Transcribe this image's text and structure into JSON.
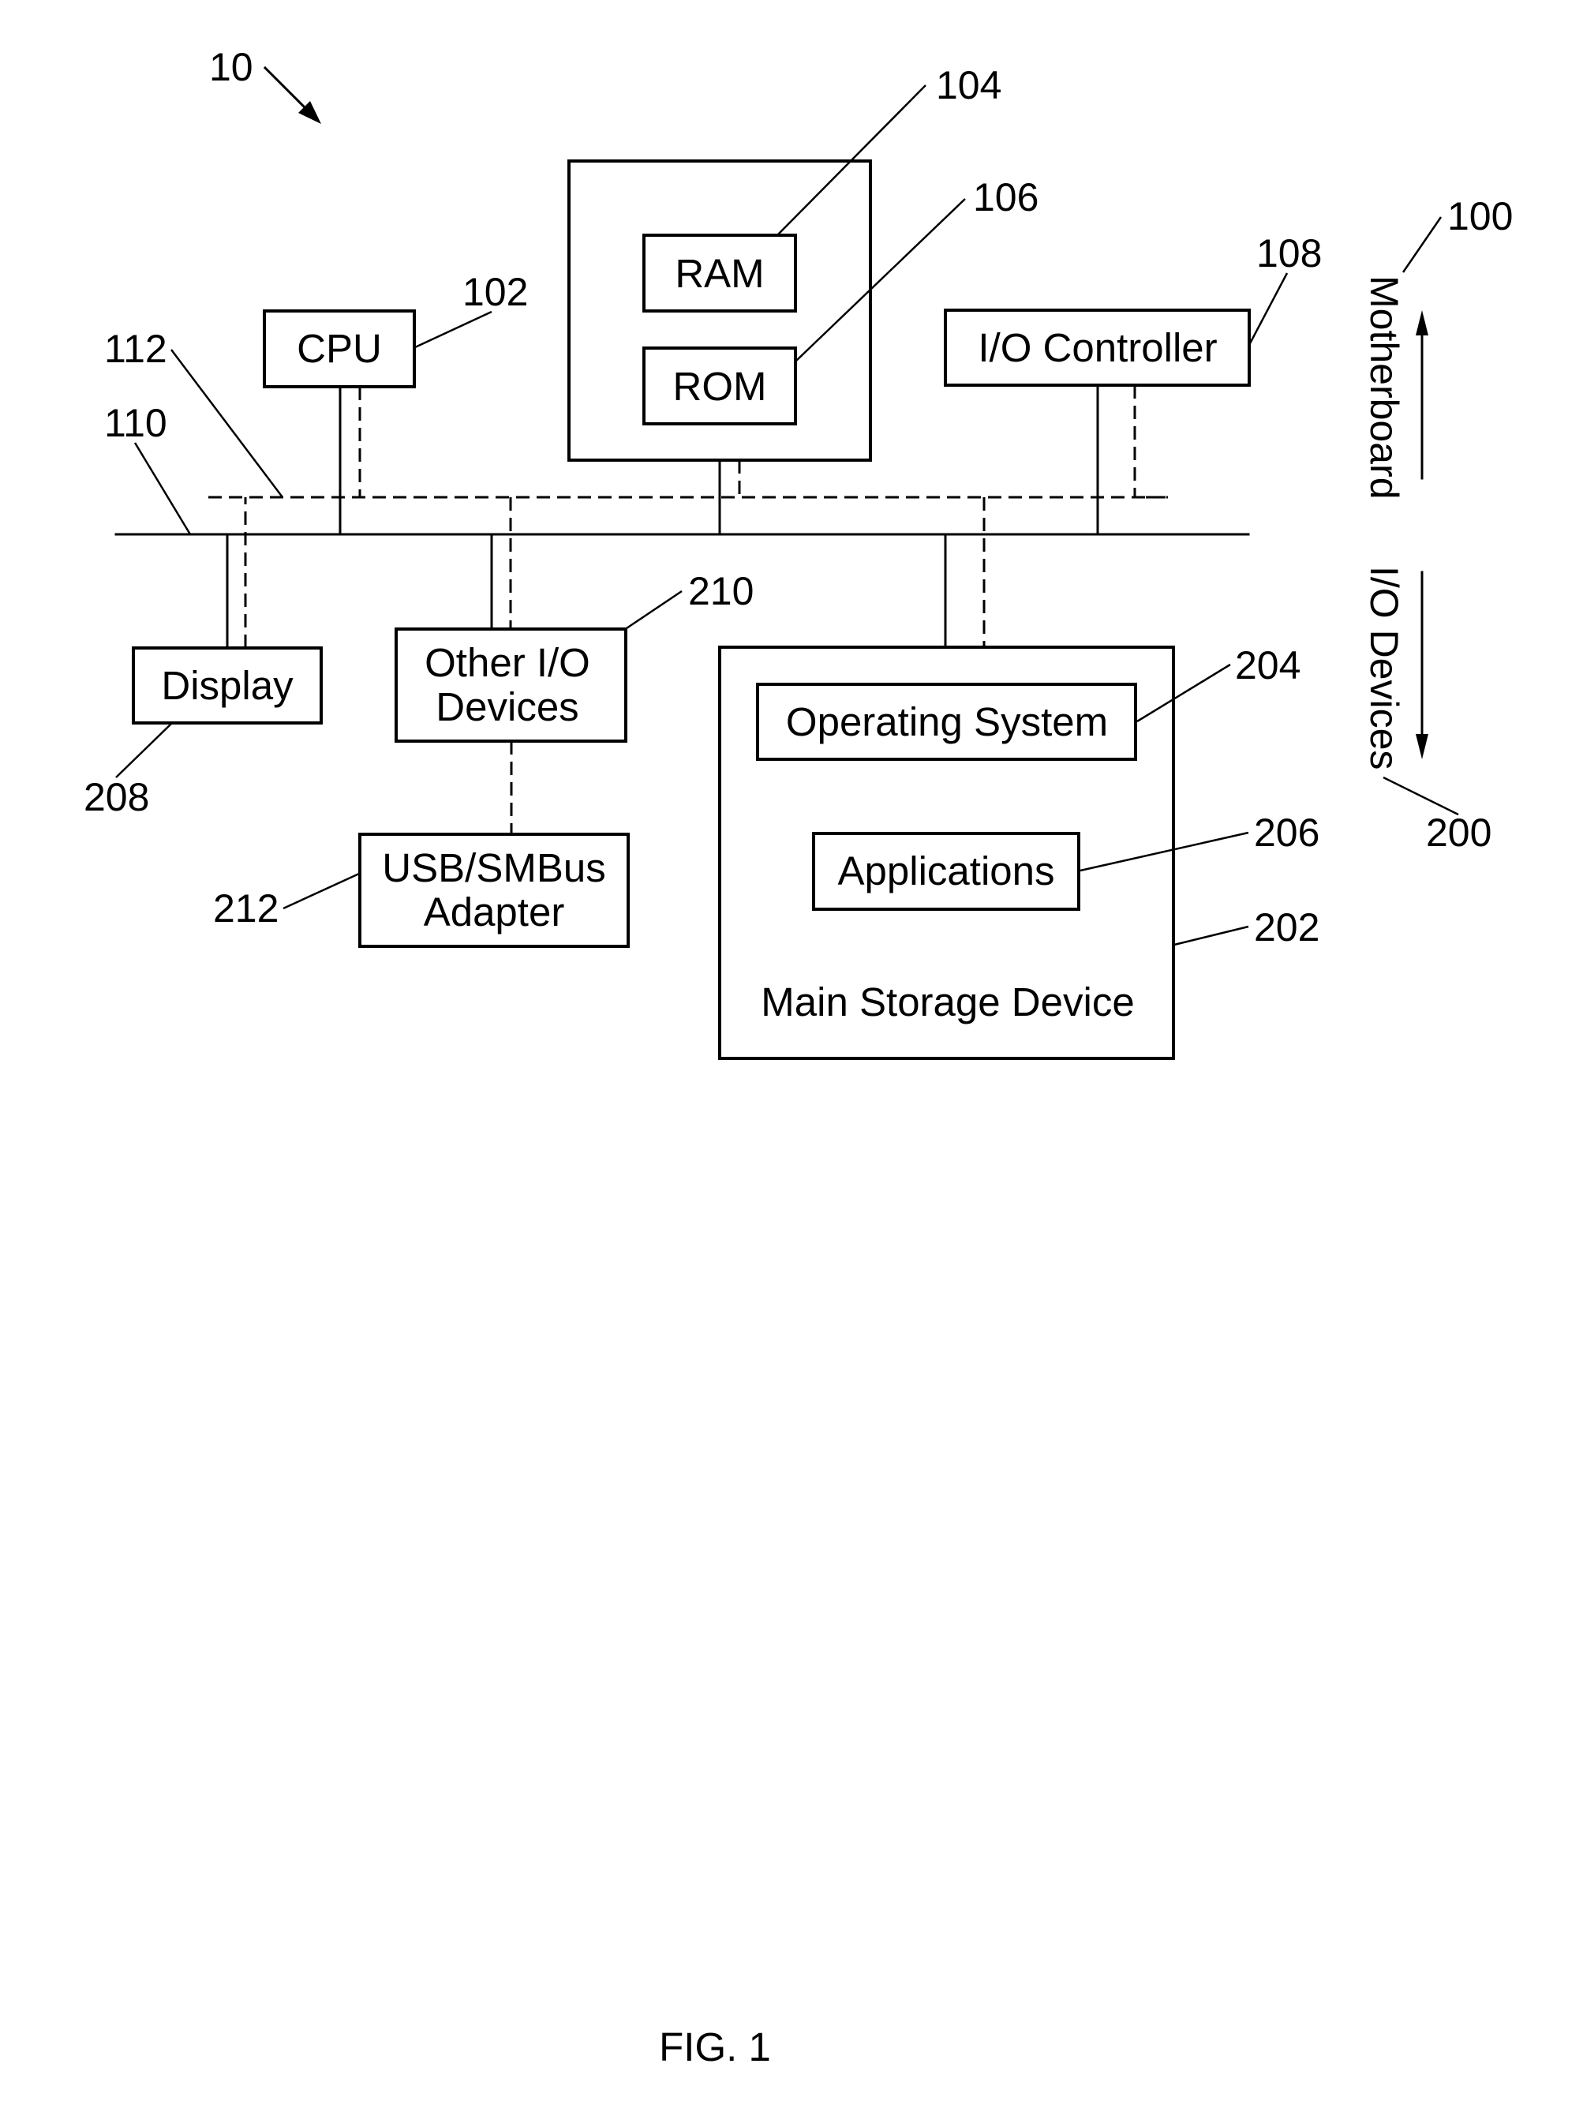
{
  "figure": {
    "caption": "FIG. 1",
    "system_ref": "10"
  },
  "motherboard": {
    "ref": "100",
    "side_label": "Motherboard",
    "arrow_direction": "up",
    "bus": {
      "ref": "110",
      "type": "solid"
    },
    "secondary_bus": {
      "ref": "112",
      "type": "dashed"
    },
    "cpu": {
      "label": "CPU",
      "ref": "102"
    },
    "memory": {
      "ram": {
        "label": "RAM",
        "ref": "104"
      },
      "rom": {
        "label": "ROM",
        "ref": "106"
      }
    },
    "io_controller": {
      "label": "I/O Controller",
      "ref": "108"
    }
  },
  "io_devices": {
    "ref": "200",
    "side_label": "I/O Devices",
    "arrow_direction": "down",
    "display": {
      "label": "Display",
      "ref": "208"
    },
    "other_io": {
      "label_line1": "Other I/O",
      "label_line2": "Devices",
      "ref": "210"
    },
    "usb_adapter": {
      "label_line1": "USB/SMBus",
      "label_line2": "Adapter",
      "ref": "212"
    },
    "main_storage": {
      "label": "Main Storage Device",
      "ref": "202",
      "operating_system": {
        "label": "Operating System",
        "ref": "204"
      },
      "applications": {
        "label": "Applications",
        "ref": "206"
      }
    }
  }
}
